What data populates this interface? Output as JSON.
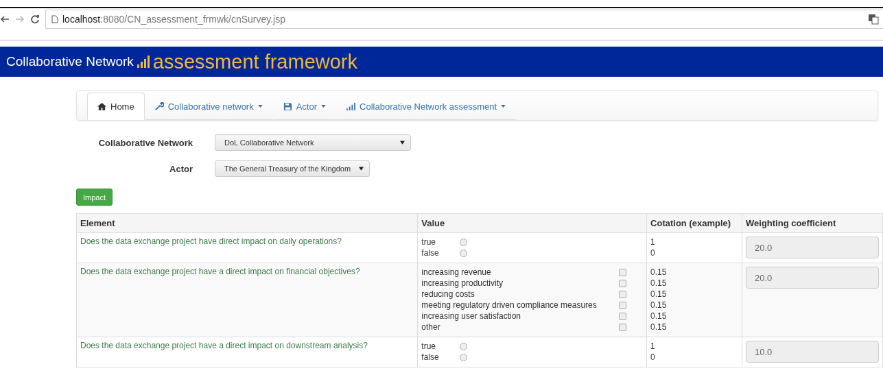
{
  "browser": {
    "url_host": "localhost",
    "url_path": ":8080/CN_assessment_frmwk/cnSurvey.jsp"
  },
  "header": {
    "title": "Collaborative Network",
    "subtitle": "assessment framework"
  },
  "tabs": [
    {
      "label": "Home",
      "selected": true,
      "dropdown": false
    },
    {
      "label": "Collaborative network",
      "selected": false,
      "dropdown": true
    },
    {
      "label": "Actor",
      "selected": false,
      "dropdown": true
    },
    {
      "label": "Collaborative Network assessment",
      "selected": false,
      "dropdown": true
    }
  ],
  "filters": [
    {
      "label": "Collaborative Network",
      "value": "DoL Collaborative Network"
    },
    {
      "label": "Actor",
      "value": "The General Treasury of the Kingdom"
    }
  ],
  "impact_button": "Impact",
  "table": {
    "columns": [
      "Element",
      "Value",
      "Cotation (example)",
      "Weighting coefficient"
    ],
    "rows": [
      {
        "element": "Does the data exchange project have direct impact on daily operations?",
        "weight": "20.0",
        "options": [
          {
            "kind": "radio",
            "label": "true",
            "cotation": "1",
            "selected": false
          },
          {
            "kind": "radio",
            "label": "false",
            "cotation": "0",
            "selected": false
          }
        ]
      },
      {
        "element": "Does the data exchange project have a direct impact on financial objectives?",
        "weight": "20.0",
        "options": [
          {
            "kind": "checkbox",
            "label": "increasing revenue",
            "cotation": "0.15",
            "checked": false
          },
          {
            "kind": "checkbox",
            "label": "increasing productivity",
            "cotation": "0.15",
            "checked": false
          },
          {
            "kind": "checkbox",
            "label": "reducing costs",
            "cotation": "0.15",
            "checked": false
          },
          {
            "kind": "checkbox",
            "label": "meeting regulatory driven compliance measures",
            "cotation": "0.15",
            "checked": false
          },
          {
            "kind": "checkbox",
            "label": "increasing user satisfaction",
            "cotation": "0.15",
            "checked": false
          },
          {
            "kind": "checkbox",
            "label": "other",
            "cotation": "0.15",
            "checked": false
          }
        ]
      },
      {
        "element": "Does the data exchange project have a direct impact on downstream analysis?",
        "weight": "10.0",
        "options": [
          {
            "kind": "radio",
            "label": "true",
            "cotation": "1",
            "selected": false
          },
          {
            "kind": "radio",
            "label": "false",
            "cotation": "0",
            "selected": false
          }
        ]
      }
    ]
  }
}
